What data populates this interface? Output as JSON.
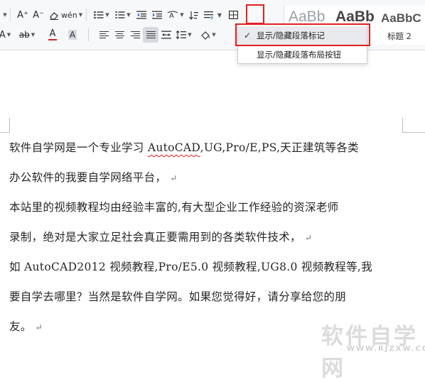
{
  "ribbon": {
    "font_tools": {
      "grow_font": "A⁺",
      "shrink_font": "A⁻",
      "phonetic": "wén"
    },
    "styles": [
      {
        "sample": "AaBb",
        "name": ""
      },
      {
        "sample": "AaBb",
        "name": ""
      },
      {
        "sample": "AaBbC",
        "name": "标题 2"
      }
    ]
  },
  "show_hide_menu": {
    "items": [
      {
        "label": "显示/隐藏段落标记",
        "checked": true
      },
      {
        "label": "显示/隐藏段落布局按钮",
        "checked": false
      }
    ]
  },
  "document": {
    "lines": [
      {
        "text": "软件自学网是一个专业学习 ",
        "spell": "AutoCAD",
        "rest": ",UG,Pro/E,PS,天正建筑等各类",
        "mark": ""
      },
      {
        "text": "办公软件的我要自学网络平台，",
        "spell": "",
        "rest": "",
        "mark": "↵"
      },
      {
        "text": "本站里的视频教程均由经验丰富的,有大型企业工作经验的资深老师",
        "spell": "",
        "rest": "",
        "mark": ""
      },
      {
        "text": "录制，绝对是大家立足社会真正要需用到的各类软件技术，",
        "spell": "",
        "rest": "",
        "mark": "↵"
      },
      {
        "text": "如 AutoCAD2012 视频教程,Pro/E5.0 视频教程,UG8.0 视频教程等,我",
        "spell": "",
        "rest": "",
        "mark": ""
      },
      {
        "text": "要自学去哪里？当然是软件自学网。如果您觉得好，请分享给您的朋",
        "spell": "",
        "rest": "",
        "mark": ""
      },
      {
        "text": "友。",
        "spell": "",
        "rest": "",
        "mark": "↵"
      }
    ]
  },
  "watermark": {
    "title": "软件自学网",
    "url": "WWW.RJZXW.COM"
  },
  "colors": {
    "highlight_red": "#e32020",
    "font_color_red": "#d42020",
    "squiggle": "#e01b1b"
  }
}
